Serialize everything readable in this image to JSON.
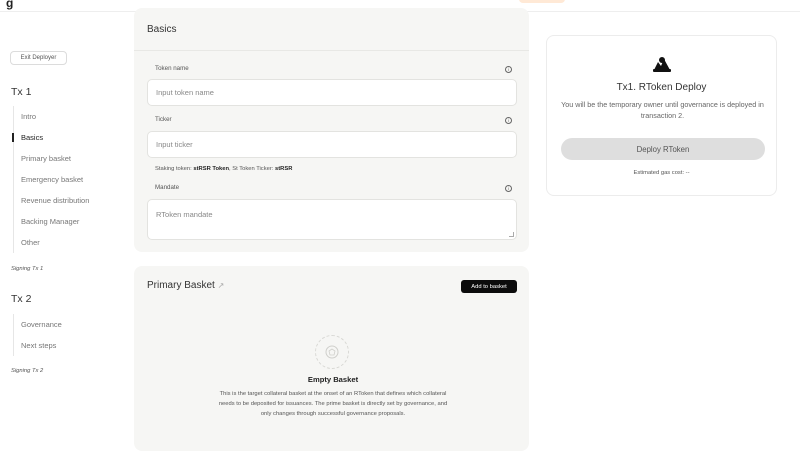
{
  "topbar": {
    "logo": "g"
  },
  "sidebar": {
    "exit_label": "Exit Deployer",
    "tx1_title": "Tx 1",
    "tx1_items": [
      "Intro",
      "Basics",
      "Primary basket",
      "Emergency basket",
      "Revenue distribution",
      "Backing Manager",
      "Other"
    ],
    "tx1_signing": "Signing Tx 1",
    "tx2_title": "Tx 2",
    "tx2_items": [
      "Governance",
      "Next steps"
    ],
    "tx2_signing": "Signing Tx 2"
  },
  "basics": {
    "title": "Basics",
    "token_name_label": "Token name",
    "token_name_placeholder": "Input token name",
    "ticker_label": "Ticker",
    "ticker_placeholder": "Input ticker",
    "staking_prefix": "Staking token: ",
    "staking_token": "stRSR Token",
    "staking_mid": ", St Token Ticker: ",
    "staking_ticker": "stRSR",
    "mandate_label": "Mandate",
    "mandate_placeholder": "RToken mandate"
  },
  "primary_basket": {
    "title": "Primary Basket",
    "add_label": "Add to basket",
    "empty_title": "Empty Basket",
    "empty_desc": "This is the target collateral basket at the onset of an RToken that defines which collateral needs to be deposited for issuances. The prime basket is directly set by governance, and only changes through successful governance proposals."
  },
  "deploy": {
    "title": "Tx1. RToken Deploy",
    "subtitle": "You will be the temporary owner until governance is deployed in transaction 2.",
    "button_label": "Deploy RToken",
    "gas_label": "Estimated gas cost: --"
  }
}
